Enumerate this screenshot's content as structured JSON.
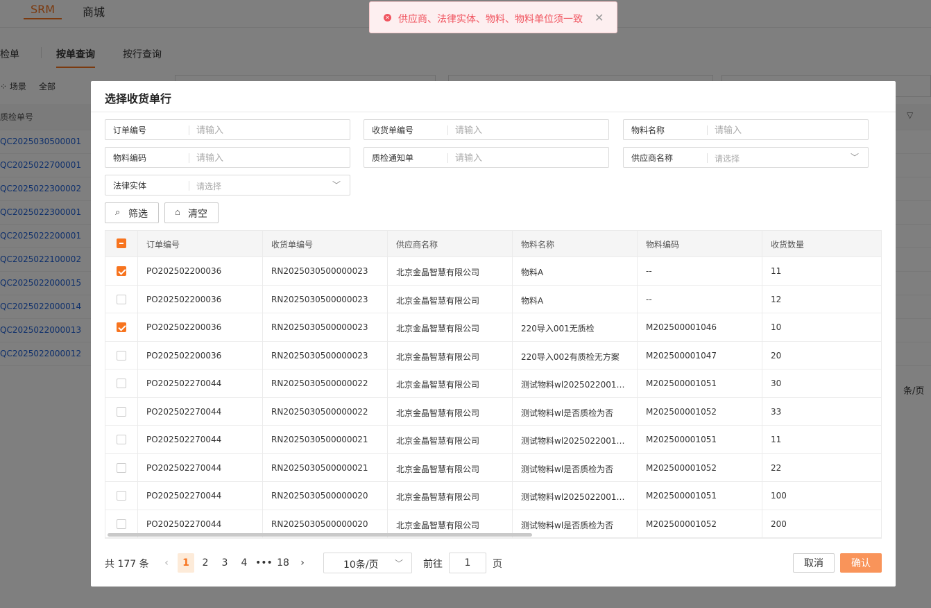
{
  "topnav": {
    "srm": "SRM",
    "mall": "商城"
  },
  "bg_tabs": [
    "检单",
    "按单查询",
    "按行查询"
  ],
  "bg_scene": "场景",
  "bg_all": "全部",
  "bg_table_header": "质检单号",
  "bg_rows": [
    "QC2025030500001",
    "QC2025022700001",
    "QC2025022300002",
    "QC2025022300001",
    "QC2025022200001",
    "QC2025022100002",
    "QC2025022000015",
    "QC2025022000014",
    "QC2025022000013",
    "QC2025022000012"
  ],
  "bg_pager_fragment": "条/页",
  "toast": {
    "message": "供应商、法律实体、物料、物料单位须一致",
    "status_color": "#f0545f"
  },
  "modal": {
    "title": "选择收货单行",
    "filters": [
      {
        "label": "订单编号",
        "placeholder": "请输入",
        "kind": "input"
      },
      {
        "label": "收货单编号",
        "placeholder": "请输入",
        "kind": "input"
      },
      {
        "label": "物料名称",
        "placeholder": "请输入",
        "kind": "input"
      },
      {
        "label": "物料编码",
        "placeholder": "请输入",
        "kind": "input"
      },
      {
        "label": "质检通知单",
        "placeholder": "请输入",
        "kind": "input"
      },
      {
        "label": "供应商名称",
        "placeholder": "请选择",
        "kind": "select"
      },
      {
        "label": "法律实体",
        "placeholder": "请选择",
        "kind": "select"
      }
    ],
    "filter_button": "筛选",
    "clear_button": "清空",
    "table": {
      "columns": [
        "订单编号",
        "收货单编号",
        "供应商名称",
        "物料名称",
        "物料编码",
        "收货数量"
      ],
      "rows": [
        {
          "checked": true,
          "cells": [
            "PO202502200036",
            "RN2025030500000023",
            "北京金晶智慧有限公司",
            "物料A",
            "--",
            "11"
          ]
        },
        {
          "checked": false,
          "cells": [
            "PO202502200036",
            "RN2025030500000023",
            "北京金晶智慧有限公司",
            "物料A",
            "--",
            "12"
          ]
        },
        {
          "checked": true,
          "cells": [
            "PO202502200036",
            "RN2025030500000023",
            "北京金晶智慧有限公司",
            "220导入001无质检",
            "M202500001046",
            "10"
          ]
        },
        {
          "checked": false,
          "cells": [
            "PO202502200036",
            "RN2025030500000023",
            "北京金晶智慧有限公司",
            "220导入002有质检无方案",
            "M202500001047",
            "20"
          ]
        },
        {
          "checked": false,
          "cells": [
            "PO202502270044",
            "RN2025030500000022",
            "北京金晶智慧有限公司",
            "测试物料wl2025022001是...",
            "M202500001051",
            "30"
          ]
        },
        {
          "checked": false,
          "cells": [
            "PO202502270044",
            "RN2025030500000022",
            "北京金晶智慧有限公司",
            "测试物料wl是否质检为否",
            "M202500001052",
            "33"
          ]
        },
        {
          "checked": false,
          "cells": [
            "PO202502270044",
            "RN2025030500000021",
            "北京金晶智慧有限公司",
            "测试物料wl2025022001是...",
            "M202500001051",
            "11"
          ]
        },
        {
          "checked": false,
          "cells": [
            "PO202502270044",
            "RN2025030500000021",
            "北京金晶智慧有限公司",
            "测试物料wl是否质检为否",
            "M202500001052",
            "22"
          ]
        },
        {
          "checked": false,
          "cells": [
            "PO202502270044",
            "RN2025030500000020",
            "北京金晶智慧有限公司",
            "测试物料wl2025022001是...",
            "M202500001051",
            "100"
          ]
        },
        {
          "checked": false,
          "cells": [
            "PO202502270044",
            "RN2025030500000020",
            "北京金晶智慧有限公司",
            "测试物料wl是否质检为否",
            "M202500001052",
            "200"
          ]
        }
      ]
    },
    "pagination": {
      "total": "共 177 条",
      "pages": [
        "1",
        "2",
        "3",
        "4",
        "•••",
        "18"
      ],
      "current": "1",
      "page_size": "10条/页",
      "goto_label": "前往",
      "goto_value": "1",
      "goto_suffix": "页"
    },
    "cancel_button": "取消",
    "confirm_button": "确认",
    "accent_color": "#f7741f"
  }
}
